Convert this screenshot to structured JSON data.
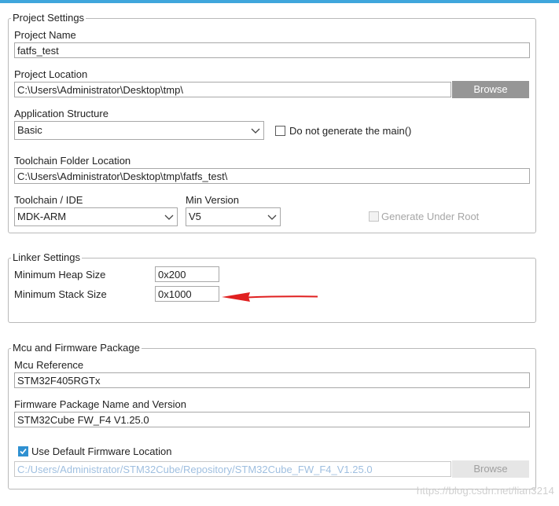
{
  "project_settings": {
    "legend": "Project Settings",
    "project_name_label": "Project Name",
    "project_name_value": "fatfs_test",
    "project_location_label": "Project Location",
    "project_location_value": "C:\\Users\\Administrator\\Desktop\\tmp\\",
    "browse_label": "Browse",
    "app_structure_label": "Application Structure",
    "app_structure_value": "Basic",
    "no_main_label": "Do not generate the main()",
    "toolchain_folder_label": "Toolchain Folder Location",
    "toolchain_folder_value": "C:\\Users\\Administrator\\Desktop\\tmp\\fatfs_test\\",
    "toolchain_ide_label": "Toolchain / IDE",
    "toolchain_ide_value": "MDK-ARM",
    "min_version_label": "Min Version",
    "min_version_value": "V5",
    "generate_under_root_label": "Generate Under Root"
  },
  "linker_settings": {
    "legend": "Linker Settings",
    "heap_label": "Minimum Heap Size",
    "heap_value": "0x200",
    "stack_label": "Minimum Stack Size",
    "stack_value": "0x1000"
  },
  "mcu_firmware": {
    "legend": "Mcu and Firmware Package",
    "mcu_ref_label": "Mcu Reference",
    "mcu_ref_value": "STM32F405RGTx",
    "fw_pkg_label": "Firmware Package Name and Version",
    "fw_pkg_value": "STM32Cube FW_F4 V1.25.0",
    "use_default_label": "Use Default Firmware Location",
    "fw_location_value": "C:/Users/Administrator/STM32Cube/Repository/STM32Cube_FW_F4_V1.25.0",
    "browse_label": "Browse"
  },
  "watermark": "https://blog.csdn.net/lian3214",
  "colors": {
    "accent": "#3fa6dc",
    "button": "#969696",
    "checkbox_checked": "#2f90d1",
    "annotation_arrow": "#e02020"
  },
  "icons": [
    "chevron-down-icon",
    "checkmark-icon",
    "red-arrow-annotation"
  ]
}
